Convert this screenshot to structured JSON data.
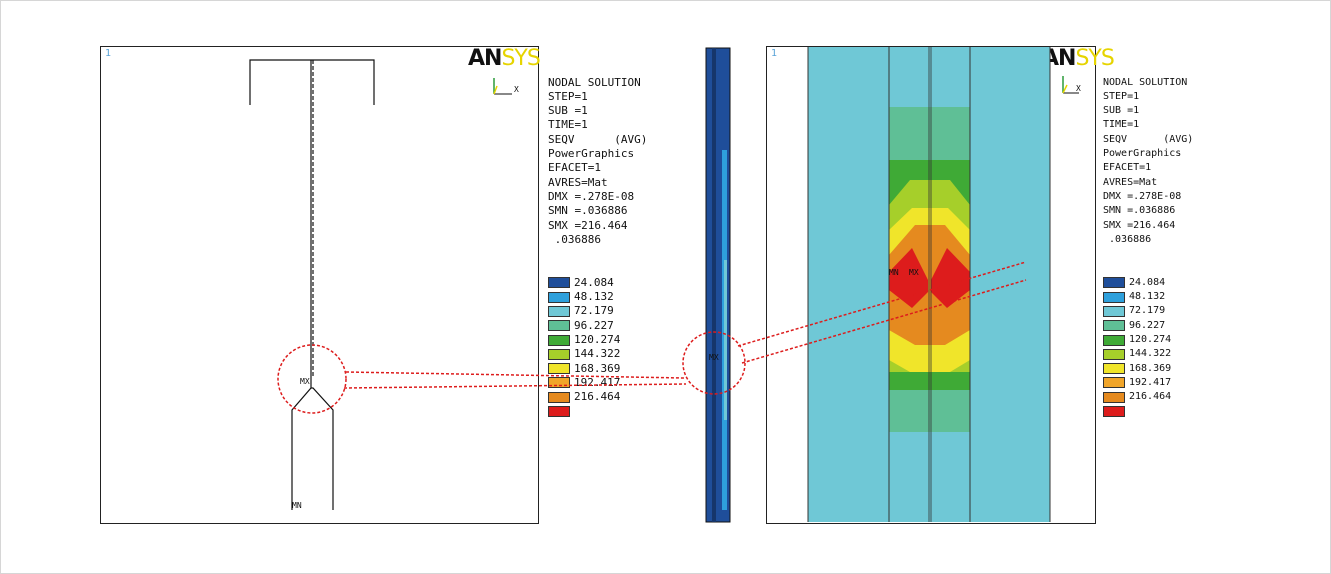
{
  "window_number_left": "1",
  "window_number_right": "1",
  "logo": {
    "part1": "AN",
    "part2": "SYS"
  },
  "triad": {
    "x_label": "X"
  },
  "markers": {
    "max": "MX",
    "min": "MN"
  },
  "legend": {
    "lines": [
      "NODAL SOLUTION",
      "STEP=1",
      "SUB =1",
      "TIME=1",
      "SEQV      (AVG)",
      "PowerGraphics",
      "EFACET=1",
      "AVRES=Mat",
      "DMX =.278E-08",
      "SMN =.036886",
      "SMX =216.464"
    ],
    "scale": [
      {
        "value": ".036886",
        "color": "#1f4e9a"
      },
      {
        "value": "24.084",
        "color": "#2ea0dc"
      },
      {
        "value": "48.132",
        "color": "#6fc8d6"
      },
      {
        "value": "72.179",
        "color": "#5fbf96"
      },
      {
        "value": "96.227",
        "color": "#3faa36"
      },
      {
        "value": "120.274",
        "color": "#a6cf2a"
      },
      {
        "value": "144.322",
        "color": "#f0e52a"
      },
      {
        "value": "168.369",
        "color": "#f0a52a"
      },
      {
        "value": "192.417",
        "color": "#e58a1f"
      },
      {
        "value": "216.464",
        "color": "#dd1c1c"
      }
    ]
  },
  "colors": {
    "callout": "#dd1c1c",
    "frame_border": "#222222",
    "window_number": "#5aa3d8"
  }
}
